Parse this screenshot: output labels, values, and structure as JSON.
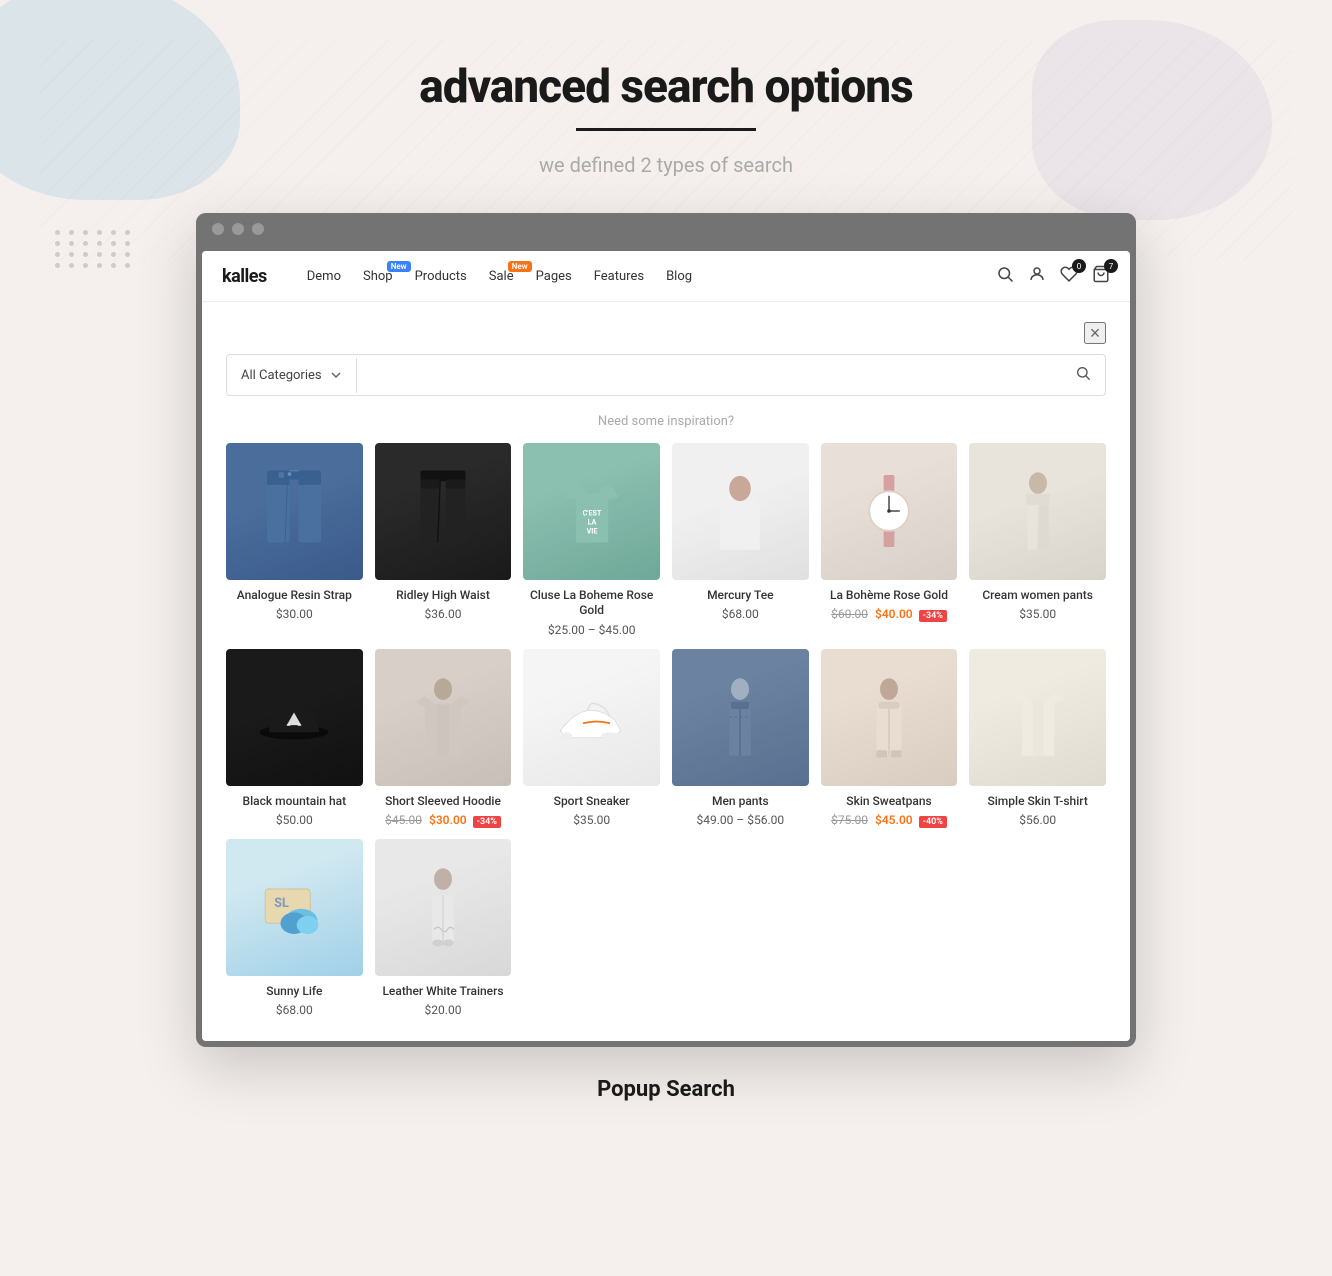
{
  "page": {
    "title": "advanced search  options",
    "title_underline": true,
    "subtitle": "we defined 2 types of search",
    "popup_label": "Popup Search"
  },
  "store": {
    "logo": "kalles",
    "nav_links": [
      {
        "label": "Demo",
        "badge": null
      },
      {
        "label": "Shop",
        "badge": {
          "text": "New",
          "color": "blue"
        }
      },
      {
        "label": "Products",
        "badge": null
      },
      {
        "label": "Sale",
        "badge": {
          "text": "New",
          "color": "orange"
        }
      },
      {
        "label": "Pages",
        "badge": null
      },
      {
        "label": "Features",
        "badge": null
      },
      {
        "label": "Blog",
        "badge": null
      }
    ],
    "nav_icons": [
      {
        "name": "search",
        "symbol": "🔍"
      },
      {
        "name": "user",
        "symbol": "👤"
      },
      {
        "name": "wishlist",
        "symbol": "♡",
        "count": "0"
      },
      {
        "name": "cart",
        "symbol": "🛒",
        "count": "7"
      }
    ]
  },
  "search_modal": {
    "close_label": "×",
    "category_placeholder": "All Categories",
    "search_placeholder": "",
    "inspiration_text": "Need some inspiration?"
  },
  "products": [
    {
      "id": 1,
      "name": "Analogue Resin Strap",
      "price": "$30.00",
      "old_price": null,
      "discount": null,
      "img_type": "watch"
    },
    {
      "id": 2,
      "name": "Ridley High Waist",
      "price": "$36.00",
      "old_price": null,
      "discount": null,
      "img_type": "black-pants"
    },
    {
      "id": 3,
      "name": "Cluse La Boheme Rose Gold",
      "price": "$25.00 – $45.00",
      "old_price": null,
      "discount": null,
      "img_type": "tshirt"
    },
    {
      "id": 4,
      "name": "Mercury Tee",
      "price": "$68.00",
      "old_price": null,
      "discount": null,
      "img_type": "white-top"
    },
    {
      "id": 5,
      "name": "La Bohème Rose Gold",
      "price": "$40.00",
      "old_price": "$60.00",
      "discount": "-34%",
      "img_type": "watch2"
    },
    {
      "id": 6,
      "name": "Cream women pants",
      "price": "$35.00",
      "old_price": null,
      "discount": null,
      "img_type": "cream-pants"
    },
    {
      "id": 7,
      "name": "Black mountain hat",
      "price": "$50.00",
      "old_price": null,
      "discount": null,
      "img_type": "black-hat"
    },
    {
      "id": 8,
      "name": "Short Sleeved Hoodie",
      "price": "$30.00",
      "old_price": "$45.00",
      "discount": "-34%",
      "img_type": "hoodie"
    },
    {
      "id": 9,
      "name": "Sport Sneaker",
      "price": "$35.00",
      "old_price": null,
      "discount": null,
      "img_type": "white-sneaker"
    },
    {
      "id": 10,
      "name": "Men pants",
      "price": "$49.00 – $56.00",
      "old_price": null,
      "discount": null,
      "img_type": "men-pants"
    },
    {
      "id": 11,
      "name": "Skin Sweatpans",
      "price": "$45.00",
      "old_price": "$75.00",
      "discount": "-40%",
      "img_type": "skin-pants"
    },
    {
      "id": 12,
      "name": "Simple Skin T-shirt",
      "price": "$56.00",
      "old_price": null,
      "discount": null,
      "img_type": "skin-tshirt"
    },
    {
      "id": 13,
      "name": "Sunny Life",
      "price": "$68.00",
      "old_price": null,
      "discount": null,
      "img_type": "sunny"
    },
    {
      "id": 14,
      "name": "Leather White Trainers",
      "price": "$20.00",
      "old_price": null,
      "discount": null,
      "img_type": "trainers"
    }
  ]
}
